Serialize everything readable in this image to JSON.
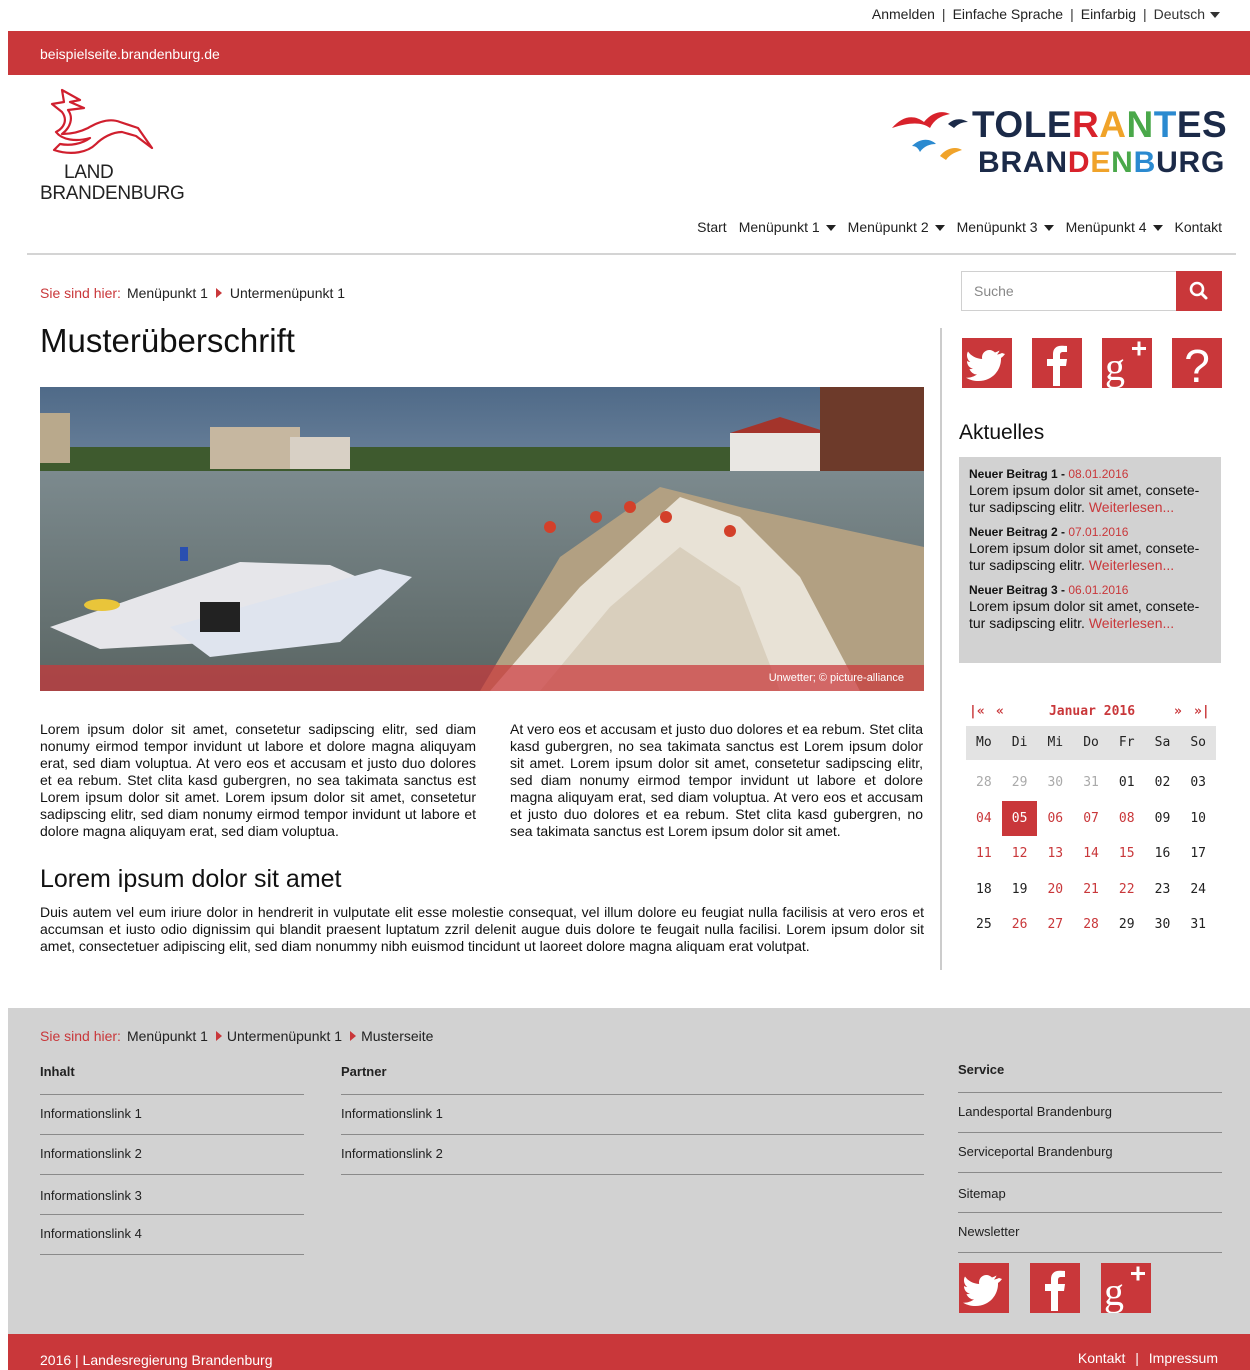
{
  "utility_nav": {
    "login": "Anmelden",
    "easy_language": "Einfache Sprache",
    "monochrome": "Einfarbig",
    "language": "Deutsch",
    "separator": "|"
  },
  "top_bar": {
    "domain": "beispielseite.brandenburg.de"
  },
  "logo_land": {
    "line1": "LAND",
    "line2": "BRANDENBURG"
  },
  "logo_tolerant": {
    "line1": "TOLERANTES",
    "line2": "BRANDENBURG"
  },
  "main_nav": {
    "start": "Start",
    "item1": "Menüpunkt 1",
    "item2": "Menüpunkt 2",
    "item3": "Menüpunkt 3",
    "item4": "Menüpunkt 4",
    "contact": "Kontakt"
  },
  "breadcrumb": {
    "label": "Sie sind hier:",
    "items": [
      "Menüpunkt 1",
      "Untermenüpunkt 1"
    ]
  },
  "search": {
    "placeholder": "Suche",
    "icon": "search-icon"
  },
  "main": {
    "title": "Musterüberschrift",
    "image_caption": "Unwetter; © picture-alliance",
    "col1": "Lorem ipsum dolor sit amet, consetetur sadipscing elitr, sed diam nonumy eirmod tempor invidunt ut labore et dolore magna aliquyam erat, sed diam voluptua. At vero eos et accusam et justo duo dolores et ea rebum. Stet clita kasd gubergren, no sea takimata sanctus est Lorem ipsum dolor sit amet. Lorem ipsum dolor sit amet, consetetur sadipscing elitr, sed diam nonumy eirmod tempor invidunt ut labore et dolore magna aliquyam erat, sed diam voluptua.",
    "col2": "At vero eos et accusam et justo duo dolores et ea rebum. Stet clita kasd gubergren, no sea takimata sanctus est Lorem ipsum dolor sit amet. Lorem ipsum dolor sit amet, consetetur sadipscing elitr, sed diam nonumy eirmod tempor invidunt ut labore et dolore magna aliquyam erat, sed diam voluptua. At vero eos et accusam et justo duo dolores et ea rebum. Stet clita kasd gubergren, no sea takimata sanctus est Lorem ipsum dolor sit amet.",
    "subtitle": "Lorem ipsum dolor sit amet",
    "body": "Duis autem vel eum iriure dolor in hendrerit in vulputate elit esse molestie consequat, vel illum dolore eu feugiat nulla facilisis at vero eros et accumsan et iusto odio dignissim qui blandit praesent luptatum zzril delenit augue duis dolore te feugait nulla facilisi. Lorem ipsum dolor sit amet, consectetuer adipiscing elit, sed diam nonummy nibh euismod tincidunt ut laoreet dolore magna aliquam erat volutpat."
  },
  "social": {
    "icons": [
      "twitter-icon",
      "facebook-icon",
      "google-plus-icon",
      "help-icon"
    ],
    "help_label": "?"
  },
  "news": {
    "title": "Aktuelles",
    "items": [
      {
        "title": "Neuer Beitrag 1",
        "date": "08.01.2016",
        "text": "Lorem ipsum dolor sit amet, consete-tur sadipscing elitr.",
        "more": "Weiterlesen..."
      },
      {
        "title": "Neuer Beitrag 2",
        "date": "07.01.2016",
        "text": "Lorem ipsum dolor sit amet, consete-tur sadipscing elitr.",
        "more": "Weiterlesen..."
      },
      {
        "title": "Neuer Beitrag 3",
        "date": "06.01.2016",
        "text": "Lorem ipsum dolor sit amet, consete-tur sadipscing elitr.",
        "more": "Weiterlesen..."
      }
    ]
  },
  "calendar": {
    "first": "|«",
    "prev": "«",
    "month": "Januar 2016",
    "next": "»",
    "last": "»|",
    "weekdays": [
      "Mo",
      "Di",
      "Mi",
      "Do",
      "Fr",
      "Sa",
      "So"
    ],
    "rows": [
      [
        "28",
        "29",
        "30",
        "31",
        "01",
        "02",
        "03"
      ],
      [
        "04",
        "05",
        "06",
        "07",
        "08",
        "09",
        "10"
      ],
      [
        "11",
        "12",
        "13",
        "14",
        "15",
        "16",
        "17"
      ],
      [
        "18",
        "19",
        "20",
        "21",
        "22",
        "23",
        "24"
      ],
      [
        "25",
        "26",
        "27",
        "28",
        "29",
        "30",
        "31"
      ]
    ],
    "selected": "05",
    "colors": {
      "accent": "#c9373a",
      "muted": "#aaaaaa",
      "normal": "#222222"
    }
  },
  "footer": {
    "breadcrumb_label": "Sie sind hier:",
    "breadcrumb": [
      "Menüpunkt 1",
      "Untermenüpunkt 1",
      "Musterseite"
    ],
    "inhalt": {
      "title": "Inhalt",
      "links": [
        "Informationslink 1",
        "Informationslink 2",
        "Informationslink 3",
        "Informationslink 4"
      ]
    },
    "partner": {
      "title": "Partner",
      "links": [
        "Informationslink 1",
        "Informationslink 2"
      ]
    },
    "service": {
      "title": "Service",
      "links": [
        "Landesportal Brandenburg",
        "Serviceportal Brandenburg",
        "Sitemap",
        "Newsletter"
      ]
    },
    "social_icons": [
      "twitter-icon",
      "facebook-icon",
      "google-plus-icon"
    ]
  },
  "bottom_bar": {
    "copyright": "2016 | Landesregierung Brandenburg",
    "contact": "Kontakt",
    "imprint": "Impressum",
    "separator": "|"
  },
  "colors": {
    "accent": "#c9373a",
    "footer_bg": "#d2d2d2",
    "news_bg": "#d2d2d2"
  }
}
